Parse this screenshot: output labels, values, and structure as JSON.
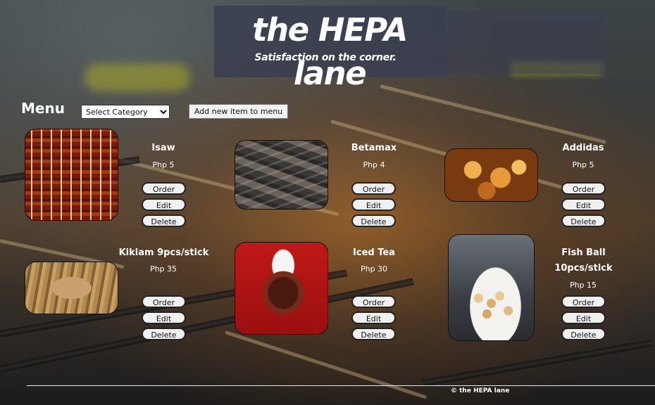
{
  "header": {
    "title": "the HEPA lane",
    "tagline": "Satisfaction on the corner."
  },
  "toolbar": {
    "menu_heading": "Menu",
    "category_select": {
      "selected": "Select Category"
    },
    "add_item_label": "Add new item to menu"
  },
  "items": [
    {
      "name": "Isaw",
      "price": "Php 5",
      "order_label": "Order",
      "edit_label": "Edit",
      "delete_label": "Delete"
    },
    {
      "name": "Betamax",
      "price": "Php 4",
      "order_label": "Order",
      "edit_label": "Edit",
      "delete_label": "Delete"
    },
    {
      "name": "Addidas",
      "price": "Php 5",
      "order_label": "Order",
      "edit_label": "Edit",
      "delete_label": "Delete"
    },
    {
      "name": "Kikiam 9pcs/stick",
      "price": "Php 35",
      "order_label": "Order",
      "edit_label": "Edit",
      "delete_label": "Delete"
    },
    {
      "name": "Iced Tea",
      "price": "Php 30",
      "order_label": "Order",
      "edit_label": "Edit",
      "delete_label": "Delete"
    },
    {
      "name": "Fish Ball 10pcs/stick",
      "price": "Php 15",
      "order_label": "Order",
      "edit_label": "Edit",
      "delete_label": "Delete"
    }
  ],
  "footer": {
    "text": "© the HEPA lane"
  }
}
